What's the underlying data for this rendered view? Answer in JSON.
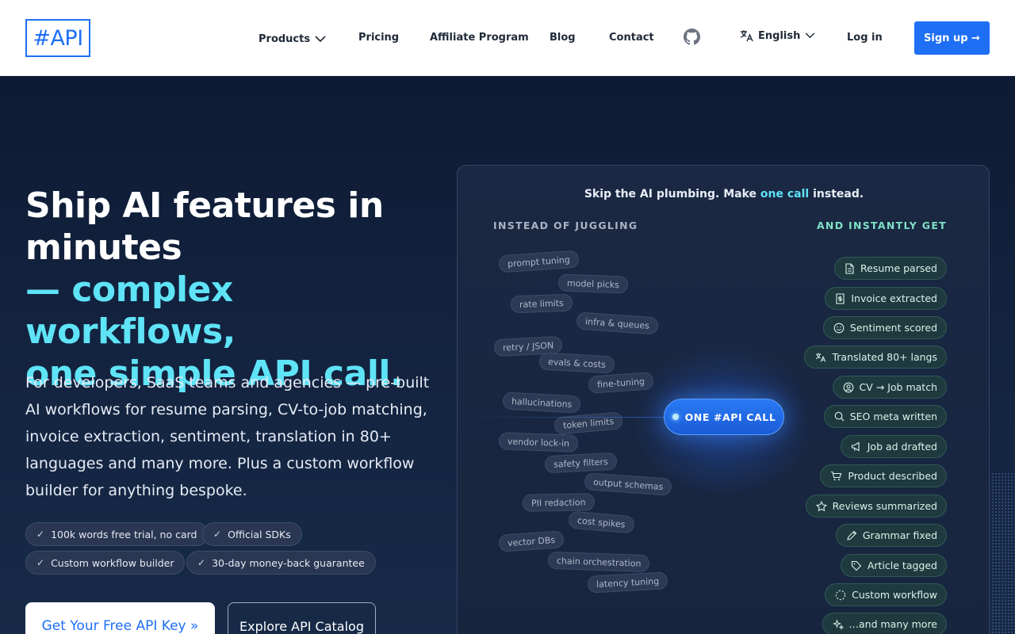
{
  "header": {
    "logo": "#API",
    "nav": {
      "products": "Products",
      "pricing": "Pricing",
      "affiliate": "Affiliate Program",
      "blog": "Blog",
      "contact": "Contact",
      "language": "English",
      "login": "Log in",
      "signup": "Sign up →"
    }
  },
  "hero": {
    "title_line1": "Ship AI features in",
    "title_line2": "minutes",
    "title_accent1": "— complex workflows,",
    "title_accent2": "one simple API call.",
    "description": "For developers, SaaS teams and agencies — pre-built AI workflows for resume parsing, CV-to-job matching, invoice extraction, sentiment, translation in 80+ languages and many more. Plus a custom workflow builder for anything bespoke.",
    "chips": [
      "100k words free trial, no card",
      "Official SDKs",
      "Custom workflow builder",
      "30-day money-back guarantee"
    ],
    "cta_primary": "Get Your Free API Key »",
    "cta_secondary": "Explore API Catalog"
  },
  "panel": {
    "headline_pre": "Skip the AI plumbing. Make ",
    "headline_hl": "one call",
    "headline_post": " instead.",
    "left_label": "INSTEAD OF JUGGLING",
    "right_label": "AND INSTANTLY GET",
    "center": "ONE #API CALL",
    "pain_points": [
      "prompt tuning",
      "model picks",
      "rate limits",
      "infra & queues",
      "retry / JSON",
      "evals & costs",
      "fine-tuning",
      "hallucinations",
      "token limits",
      "vendor lock-in",
      "safety filters",
      "output schemas",
      "PII redaction",
      "cost spikes",
      "vector DBs",
      "chain orchestration",
      "latency tuning"
    ],
    "outputs": [
      {
        "label": "Resume parsed",
        "icon": "document-icon"
      },
      {
        "label": "Invoice extracted",
        "icon": "invoice-icon"
      },
      {
        "label": "Sentiment scored",
        "icon": "smile-icon"
      },
      {
        "label": "Translated 80+ langs",
        "icon": "translate-icon"
      },
      {
        "label": "CV → Job match",
        "icon": "user-circle-icon"
      },
      {
        "label": "SEO meta written",
        "icon": "search-icon"
      },
      {
        "label": "Job ad drafted",
        "icon": "megaphone-icon"
      },
      {
        "label": "Product described",
        "icon": "cart-icon"
      },
      {
        "label": "Reviews summarized",
        "icon": "star-icon"
      },
      {
        "label": "Grammar fixed",
        "icon": "pen-icon"
      },
      {
        "label": "Article tagged",
        "icon": "tag-icon"
      },
      {
        "label": "Custom workflow",
        "icon": "dashed-circle-icon"
      },
      {
        "label": "…and many more",
        "icon": "sparkles-icon"
      }
    ]
  },
  "colors": {
    "brand_blue": "#1e6ff5",
    "accent_cyan": "#5fe3f7",
    "hero_bg": "#13233f",
    "output_green": "#7fe0c5"
  }
}
